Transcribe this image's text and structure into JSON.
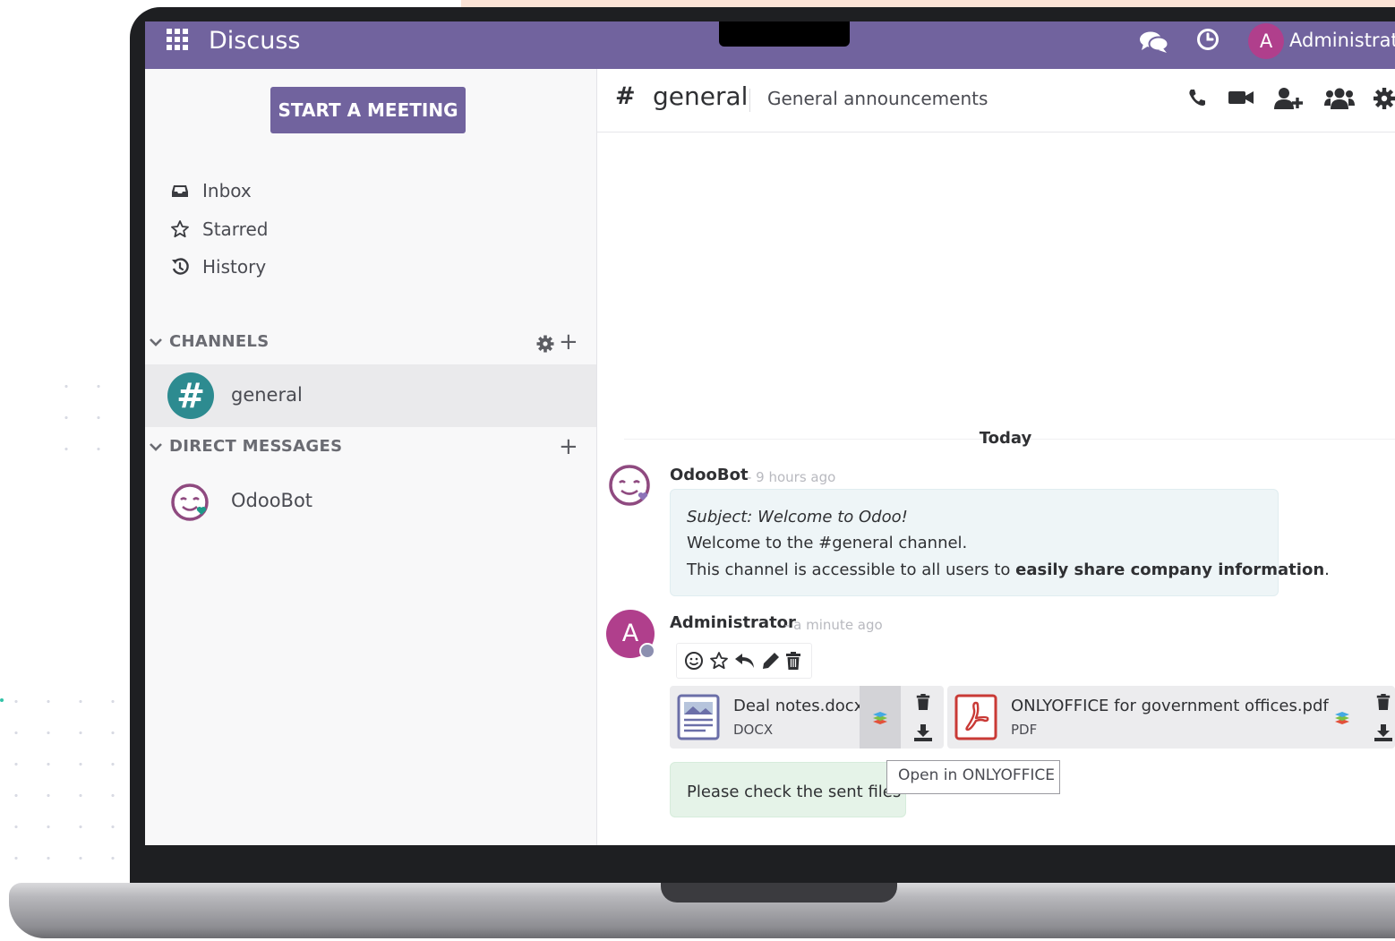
{
  "navbar": {
    "app_title": "Discuss",
    "user_initial": "A",
    "user_name": "Administrator"
  },
  "sidebar": {
    "start_meeting_label": "START A MEETING",
    "menu": [
      {
        "label": "Inbox",
        "icon": "inbox-icon"
      },
      {
        "label": "Starred",
        "icon": "star-icon"
      },
      {
        "label": "History",
        "icon": "history-icon"
      }
    ],
    "channels_title": "CHANNELS",
    "channels": [
      {
        "label": "general",
        "icon": "hash-icon"
      }
    ],
    "dm_title": "DIRECT MESSAGES",
    "direct_messages": [
      {
        "label": "OdooBot"
      }
    ]
  },
  "channel": {
    "hash": "#",
    "name": "general",
    "description": "General announcements"
  },
  "thread": {
    "date_separator": "Today",
    "messages": [
      {
        "author": "OdooBot",
        "time": "- 9 hours ago",
        "subject": "Subject: Welcome to Odoo!",
        "line1": "Welcome to the #general channel.",
        "line2_prefix": "This channel is accessible to all users to ",
        "line2_bold": "easily share company information",
        "line2_suffix": "."
      },
      {
        "author": "Administrator",
        "avatar_initial": "A",
        "time": "- a minute ago",
        "attachments": [
          {
            "name": "Deal notes.docx",
            "type": "DOCX"
          },
          {
            "name": "ONLYOFFICE for government offices.pdf",
            "type": "PDF"
          }
        ],
        "body": "Please check the sent files"
      }
    ],
    "tooltip": "Open in ONLYOFFICE"
  },
  "colors": {
    "brand": "#71639e",
    "channel_avatar": "#2d8b90",
    "admin_avatar": "#b03f8c"
  }
}
